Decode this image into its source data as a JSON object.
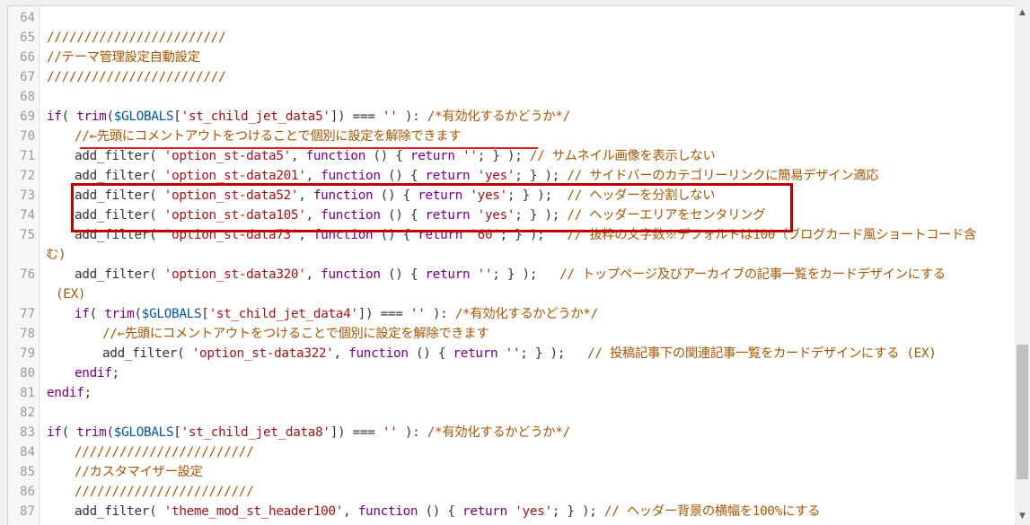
{
  "editor": {
    "lines": [
      {
        "num": "64",
        "indent": 0,
        "segs": []
      },
      {
        "num": "65",
        "indent": 0,
        "segs": [
          {
            "t": "c",
            "s": "////////////////////////"
          }
        ]
      },
      {
        "num": "66",
        "indent": 0,
        "segs": [
          {
            "t": "c",
            "s": "//テーマ管理設定自動設定"
          }
        ]
      },
      {
        "num": "67",
        "indent": 0,
        "segs": [
          {
            "t": "c",
            "s": "////////////////////////"
          }
        ]
      },
      {
        "num": "68",
        "indent": 0,
        "segs": []
      },
      {
        "num": "69",
        "indent": 0,
        "segs": [
          {
            "t": "k",
            "s": "if"
          },
          {
            "t": "p",
            "s": "( "
          },
          {
            "t": "k",
            "s": "trim"
          },
          {
            "t": "p",
            "s": "("
          },
          {
            "t": "v",
            "s": "$GLOBALS"
          },
          {
            "t": "p",
            "s": "["
          },
          {
            "t": "s",
            "s": "'st_child_jet_data5'"
          },
          {
            "t": "p",
            "s": "]) === "
          },
          {
            "t": "s",
            "s": "''"
          },
          {
            "t": "p",
            "s": " ): "
          },
          {
            "t": "c",
            "s": "/*有効化するかどうか*/"
          }
        ]
      },
      {
        "num": "70",
        "indent": 1,
        "segs": [
          {
            "t": "c",
            "s": "//←先頭にコメントアウトをつけることで個別に設定を解除できます"
          }
        ]
      },
      {
        "num": "71",
        "indent": 1,
        "segs": [
          {
            "t": "f",
            "s": "add_filter"
          },
          {
            "t": "p",
            "s": "( "
          },
          {
            "t": "s",
            "s": "'option_st-data5'"
          },
          {
            "t": "p",
            "s": ", "
          },
          {
            "t": "k",
            "s": "function"
          },
          {
            "t": "p",
            "s": " () { "
          },
          {
            "t": "k",
            "s": "return"
          },
          {
            "t": "p",
            "s": " "
          },
          {
            "t": "s",
            "s": "''"
          },
          {
            "t": "p",
            "s": "; } ); "
          },
          {
            "t": "c",
            "s": "// サムネイル画像を表示しない"
          }
        ]
      },
      {
        "num": "72",
        "indent": 1,
        "segs": [
          {
            "t": "f",
            "s": "add_filter"
          },
          {
            "t": "p",
            "s": "( "
          },
          {
            "t": "s",
            "s": "'option_st-data201'"
          },
          {
            "t": "p",
            "s": ", "
          },
          {
            "t": "k",
            "s": "function"
          },
          {
            "t": "p",
            "s": " () { "
          },
          {
            "t": "k",
            "s": "return"
          },
          {
            "t": "p",
            "s": " "
          },
          {
            "t": "s",
            "s": "'yes'"
          },
          {
            "t": "p",
            "s": "; } ); "
          },
          {
            "t": "c",
            "s": "// サイドバーのカテゴリーリンクに簡易デザイン適応"
          }
        ]
      },
      {
        "num": "73",
        "indent": 1,
        "segs": [
          {
            "t": "f",
            "s": "add_filter"
          },
          {
            "t": "p",
            "s": "( "
          },
          {
            "t": "s",
            "s": "'option_st-data52'"
          },
          {
            "t": "p",
            "s": ", "
          },
          {
            "t": "k",
            "s": "function"
          },
          {
            "t": "p",
            "s": " () { "
          },
          {
            "t": "k",
            "s": "return"
          },
          {
            "t": "p",
            "s": " "
          },
          {
            "t": "s",
            "s": "'yes'"
          },
          {
            "t": "p",
            "s": "; } );  "
          },
          {
            "t": "c",
            "s": "// ヘッダーを分割しない"
          }
        ]
      },
      {
        "num": "74",
        "indent": 1,
        "segs": [
          {
            "t": "f",
            "s": "add_filter"
          },
          {
            "t": "p",
            "s": "( "
          },
          {
            "t": "s",
            "s": "'option_st-data105'"
          },
          {
            "t": "p",
            "s": ", "
          },
          {
            "t": "k",
            "s": "function"
          },
          {
            "t": "p",
            "s": " () { "
          },
          {
            "t": "k",
            "s": "return"
          },
          {
            "t": "p",
            "s": " "
          },
          {
            "t": "s",
            "s": "'yes'"
          },
          {
            "t": "p",
            "s": "; } ); "
          },
          {
            "t": "c",
            "s": "// ヘッダーエリアをセンタリング"
          }
        ]
      },
      {
        "num": "75",
        "indent": 1,
        "segs": [
          {
            "t": "f",
            "s": "add_filter"
          },
          {
            "t": "p",
            "s": "( "
          },
          {
            "t": "s",
            "s": "'option_st-data73'"
          },
          {
            "t": "p",
            "s": ", "
          },
          {
            "t": "k",
            "s": "function"
          },
          {
            "t": "p",
            "s": " () { "
          },
          {
            "t": "k",
            "s": "return"
          },
          {
            "t": "p",
            "s": " "
          },
          {
            "t": "s",
            "s": "'60'"
          },
          {
            "t": "p",
            "s": "; } );   "
          },
          {
            "t": "c",
            "s": "// 抜粋の文字数※デフォルトは100（ブログカード風ショートコード含"
          }
        ]
      },
      {
        "num": "",
        "indent": -1,
        "segs": [
          {
            "t": "c",
            "s": "む)"
          }
        ]
      },
      {
        "num": "76",
        "indent": 1,
        "segs": [
          {
            "t": "f",
            "s": "add_filter"
          },
          {
            "t": "p",
            "s": "( "
          },
          {
            "t": "s",
            "s": "'option_st-data320'"
          },
          {
            "t": "p",
            "s": ", "
          },
          {
            "t": "k",
            "s": "function"
          },
          {
            "t": "p",
            "s": " () { "
          },
          {
            "t": "k",
            "s": "return"
          },
          {
            "t": "p",
            "s": " "
          },
          {
            "t": "s",
            "s": "''"
          },
          {
            "t": "p",
            "s": "; } );   "
          },
          {
            "t": "c",
            "s": "// トップページ及びアーカイブの記事一覧をカードデザインにする"
          }
        ]
      },
      {
        "num": "",
        "indent": -0.6,
        "segs": [
          {
            "t": "c",
            "s": "(EX)"
          }
        ]
      },
      {
        "num": "77",
        "indent": 1,
        "segs": [
          {
            "t": "k",
            "s": "if"
          },
          {
            "t": "p",
            "s": "( "
          },
          {
            "t": "k",
            "s": "trim"
          },
          {
            "t": "p",
            "s": "("
          },
          {
            "t": "v",
            "s": "$GLOBALS"
          },
          {
            "t": "p",
            "s": "["
          },
          {
            "t": "s",
            "s": "'st_child_jet_data4'"
          },
          {
            "t": "p",
            "s": "]) === "
          },
          {
            "t": "s",
            "s": "''"
          },
          {
            "t": "p",
            "s": " ): "
          },
          {
            "t": "c",
            "s": "/*有効化するかどうか*/"
          }
        ]
      },
      {
        "num": "78",
        "indent": 2,
        "segs": [
          {
            "t": "c",
            "s": "//←先頭にコメントアウトをつけることで個別に設定を解除できます"
          }
        ]
      },
      {
        "num": "79",
        "indent": 2,
        "segs": [
          {
            "t": "f",
            "s": "add_filter"
          },
          {
            "t": "p",
            "s": "( "
          },
          {
            "t": "s",
            "s": "'option_st-data322'"
          },
          {
            "t": "p",
            "s": ", "
          },
          {
            "t": "k",
            "s": "function"
          },
          {
            "t": "p",
            "s": " () { "
          },
          {
            "t": "k",
            "s": "return"
          },
          {
            "t": "p",
            "s": " "
          },
          {
            "t": "s",
            "s": "''"
          },
          {
            "t": "p",
            "s": "; } );   "
          },
          {
            "t": "c",
            "s": "// 投稿記事下の関連記事一覧をカードデザインにする (EX)"
          }
        ]
      },
      {
        "num": "80",
        "indent": 1,
        "segs": [
          {
            "t": "k",
            "s": "endif"
          },
          {
            "t": "p",
            "s": ";"
          }
        ]
      },
      {
        "num": "81",
        "indent": 0,
        "segs": [
          {
            "t": "k",
            "s": "endif"
          },
          {
            "t": "p",
            "s": ";"
          }
        ]
      },
      {
        "num": "82",
        "indent": 0,
        "segs": []
      },
      {
        "num": "83",
        "indent": 0,
        "segs": [
          {
            "t": "k",
            "s": "if"
          },
          {
            "t": "p",
            "s": "( "
          },
          {
            "t": "k",
            "s": "trim"
          },
          {
            "t": "p",
            "s": "("
          },
          {
            "t": "v",
            "s": "$GLOBALS"
          },
          {
            "t": "p",
            "s": "["
          },
          {
            "t": "s",
            "s": "'st_child_jet_data8'"
          },
          {
            "t": "p",
            "s": "]) === "
          },
          {
            "t": "s",
            "s": "''"
          },
          {
            "t": "p",
            "s": " ): "
          },
          {
            "t": "c",
            "s": "/*有効化するかどうか*/"
          }
        ]
      },
      {
        "num": "84",
        "indent": 1,
        "segs": [
          {
            "t": "c",
            "s": "////////////////////////"
          }
        ]
      },
      {
        "num": "85",
        "indent": 1,
        "segs": [
          {
            "t": "c",
            "s": "//カスタマイザー設定"
          }
        ]
      },
      {
        "num": "86",
        "indent": 1,
        "segs": [
          {
            "t": "c",
            "s": "////////////////////////"
          }
        ]
      },
      {
        "num": "87",
        "indent": 1,
        "segs": [
          {
            "t": "f",
            "s": "add_filter"
          },
          {
            "t": "p",
            "s": "( "
          },
          {
            "t": "s",
            "s": "'theme_mod_st_header100'"
          },
          {
            "t": "p",
            "s": ", "
          },
          {
            "t": "k",
            "s": "function"
          },
          {
            "t": "p",
            "s": " () { "
          },
          {
            "t": "k",
            "s": "return"
          },
          {
            "t": "p",
            "s": " "
          },
          {
            "t": "s",
            "s": "'yes'"
          },
          {
            "t": "p",
            "s": "; } ); "
          },
          {
            "t": "c",
            "s": "// ヘッダー背景の横幅を100%にする"
          }
        ]
      }
    ]
  },
  "colors": {
    "comment": "#aa5500",
    "keyword": "#770088",
    "string": "#aa1111",
    "variable": "#0055aa",
    "annotation_red": "#c00000"
  },
  "icons": {
    "scroll_up": "▲",
    "scroll_down": "▼"
  }
}
